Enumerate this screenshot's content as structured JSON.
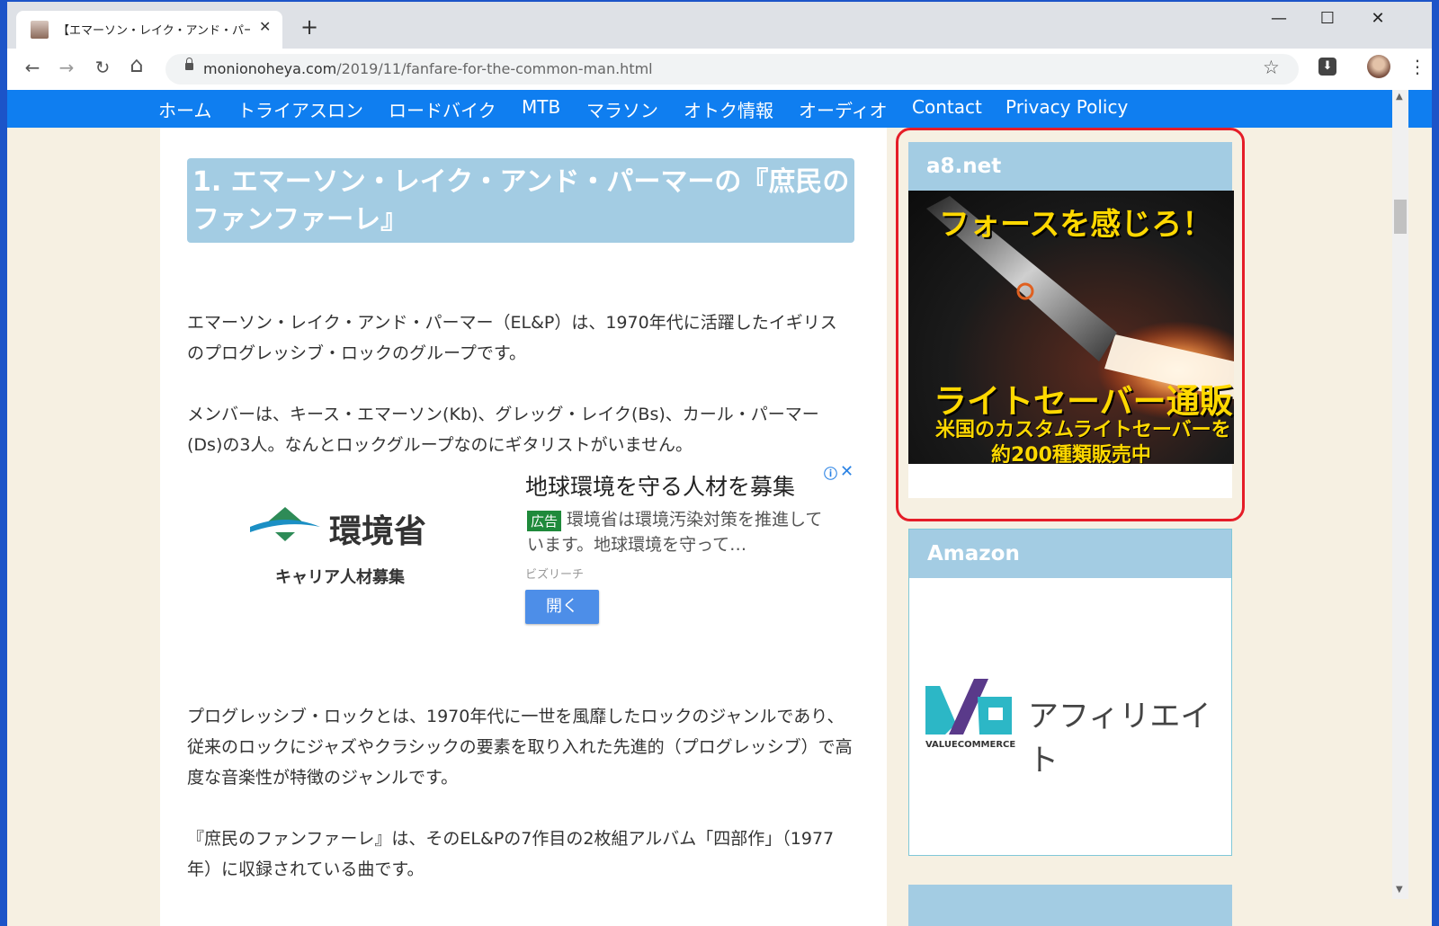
{
  "tab": {
    "title": "【エマーソン・レイク・アンド・パーマーの『庶民のファンファーレ』"
  },
  "window": {
    "minimize": "—",
    "maximize": "☐",
    "close": "✕"
  },
  "toolbar": {
    "back": "←",
    "forward": "→",
    "reload": "↻",
    "home": "⌂",
    "url_host": "monionoheya.com",
    "url_path": "/2019/11/fanfare-for-the-common-man.html",
    "star": "☆",
    "ext": "⬇",
    "kebab": "⋮"
  },
  "nav": [
    "ホーム",
    "トライアスロン",
    "ロードバイク",
    "MTB",
    "マラソン",
    "オトク情報",
    "オーディオ",
    "Contact",
    "Privacy Policy"
  ],
  "article": {
    "heading": "1. エマーソン・レイク・アンド・パーマーの『庶民のファンファーレ』",
    "p1": "エマーソン・レイク・アンド・パーマー（EL&P）は、1970年代に活躍したイギリスのプログレッシブ・ロックのグループです。",
    "p2": "メンバーは、キース・エマーソン(Kb)、グレッグ・レイク(Bs)、カール・パーマー(Ds)の3人。なんとロックグループなのにギタリストがいません。",
    "p3": "プログレッシブ・ロックとは、1970年代に一世を風靡したロックのジャンルであり、従来のロックにジャズやクラシックの要素を取り入れた先進的（プログレッシブ）で高度な音楽性が特徴のジャンルです。",
    "p4": "『庶民のファンファーレ』は、そのEL&Pの7作目の2枚組アルバム「四部作」（1977年）に収録されている曲です。"
  },
  "ad": {
    "org": "環境省",
    "career": "キャリア人材募集",
    "headline": "地球環境を守る人材を募集",
    "badge": "広告",
    "desc": "環境省は環境汚染対策を推進しています。地球環境を守って…",
    "source": "ビズリーチ",
    "open": "開く",
    "info": "ⓘ",
    "close": "✕",
    "accent": "#1f8a3b"
  },
  "sidebar": {
    "a8_title": "a8.net",
    "banner": {
      "line1": "フォースを感じろ！",
      "line2": "ライトセーバー通販",
      "line3": "米国のカスタムライトセーバーを",
      "line4": "約200種類販売中"
    },
    "amazon_title": "Amazon",
    "vc_word": "アフィリエイト",
    "vc_sub": "VALUECOMMERCE"
  },
  "colors": {
    "navbar": "#0f7ef0",
    "heading_bg": "#a3cce3",
    "highlight": "#e51d28",
    "page_bg": "#f6f0e2"
  }
}
